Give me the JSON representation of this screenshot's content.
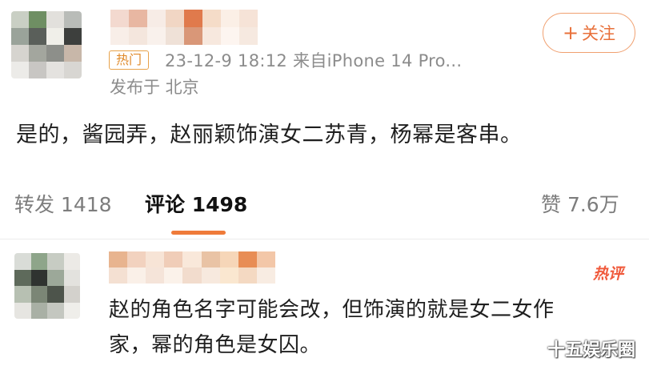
{
  "post": {
    "hot_badge": "热门",
    "meta": "23-12-9 18:12  来自iPhone 14 Pro...",
    "location": "发布于 北京",
    "follow_plus": "+",
    "follow_label": "关注",
    "text": "是的，酱园弄，赵丽颖饰演女二苏青，杨幂是客串。"
  },
  "tabs": {
    "repost": "转发 1418",
    "comment": "评论 1498",
    "like": "赞 7.6万"
  },
  "comment": {
    "tag": "热评",
    "line1": "赵的角色名字可能会改，但饰演的就是女二女作",
    "line2": "家，幂的角色是女囚。"
  },
  "watermark": "十五娱乐圈",
  "colors": {
    "accent": "#ef7b3a",
    "hot_badge": "#e8a24a",
    "hot_comment": "#f05a3c",
    "meta_gray": "#8c8c8c"
  },
  "mosaics": {
    "avatar1": [
      "#c9cfc4",
      "#6f8f63",
      "#e2e0dc",
      "#b9bcb8",
      "#9aa39a",
      "#5a5f5a",
      "#f0efe9",
      "#3d3f3d",
      "#d6d4cf",
      "#a3a69e",
      "#8d8f8a",
      "#c8b7a9",
      "#ecebe8",
      "#c8c6c3",
      "#e4e2df",
      "#d8d6d2"
    ],
    "name1": [
      "#f3d9cf",
      "#e8b7a2",
      "#f7ece6",
      "#f1d6c4",
      "#e07a4c",
      "#f5dcc8",
      "#fbefe6",
      "#f6e3d7",
      "#f8eee8",
      "#f4e6dd",
      "#f9f1ec",
      "#efe1d7",
      "#d99778",
      "#f7e8de",
      "#fdf5f0",
      "#f6e9e0"
    ],
    "avatar2": [
      "#d9dcd7",
      "#8ea58a",
      "#c7ccc3",
      "#eceae6",
      "#5e6a5b",
      "#2f3330",
      "#9ca899",
      "#e3e2de",
      "#b7c0b2",
      "#7b8676",
      "#4d544b",
      "#d3d1cc",
      "#e6e5e1",
      "#a9b0a5",
      "#c4c7c0",
      "#efeeea"
    ],
    "name2": [
      "#e8b48f",
      "#f2d2bf",
      "#f7e4d6",
      "#f0cdb8",
      "#f9e8da",
      "#e9c3a5",
      "#f6d6b8",
      "#e88d55",
      "#f3c7a8",
      "#f4e0d2",
      "#faf0e8",
      "#f5e4d9",
      "#fbf2ea",
      "#f2dccd",
      "#f7e9de",
      "#fae7d0",
      "#f4d9c2",
      "#f8ece2"
    ]
  }
}
